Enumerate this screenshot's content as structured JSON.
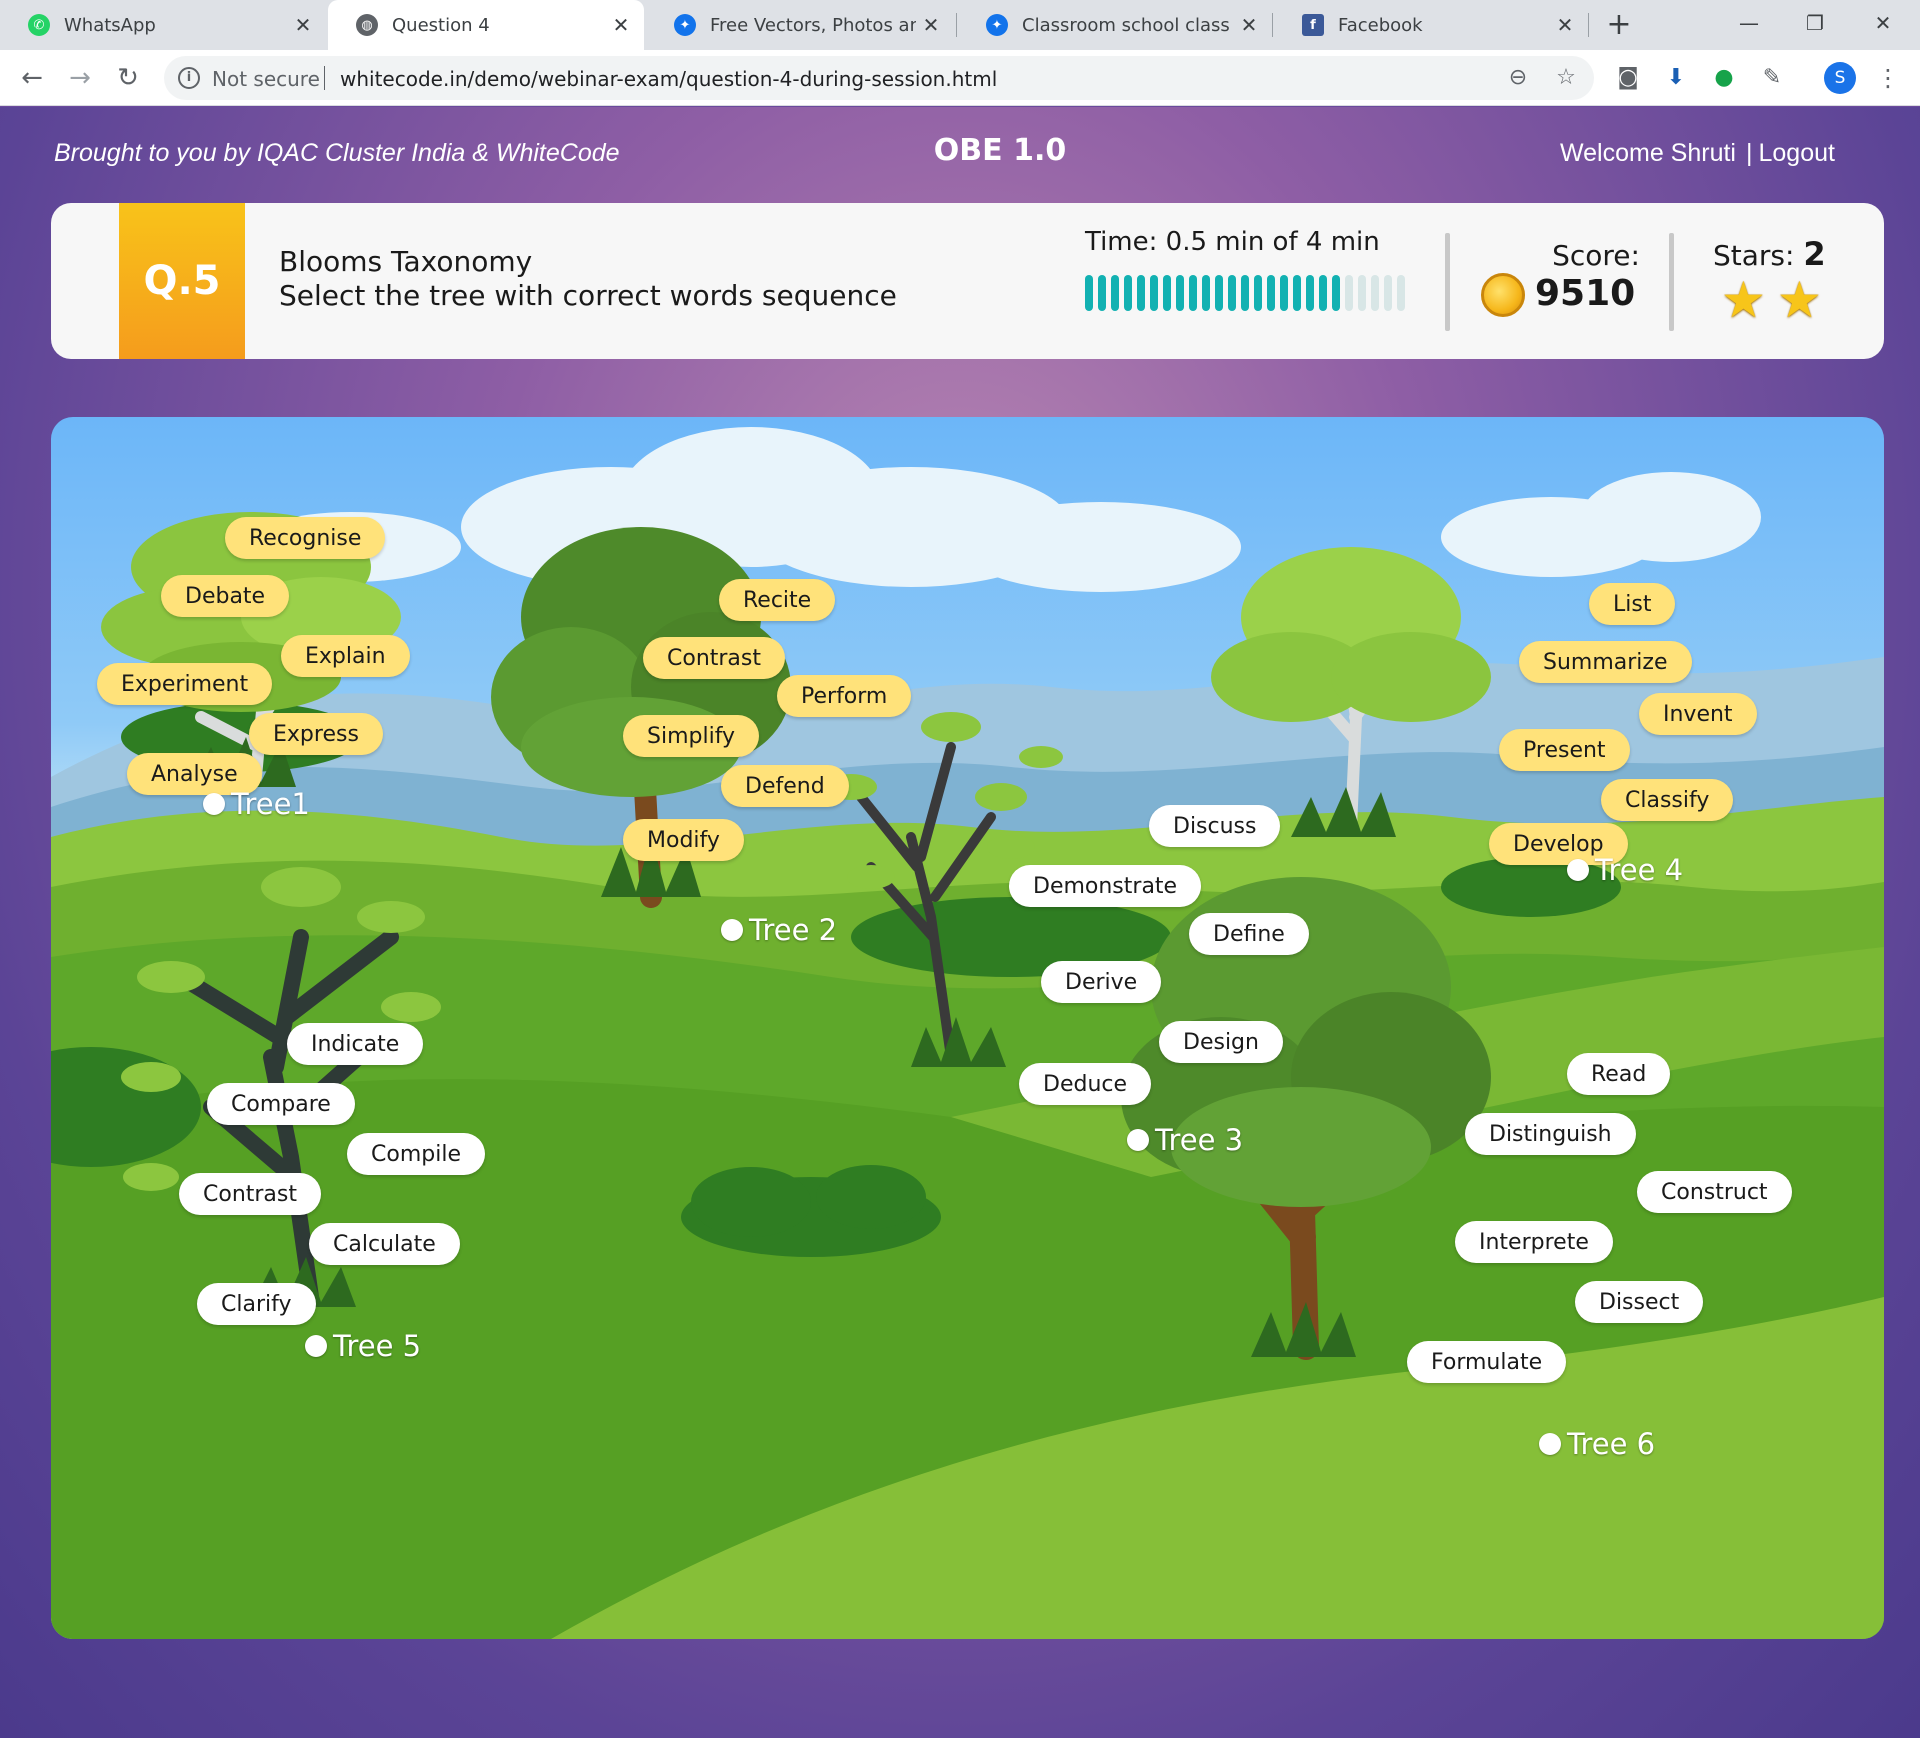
{
  "browser": {
    "tabs": [
      {
        "title": "WhatsApp",
        "icon": "whatsapp-icon",
        "active": false
      },
      {
        "title": "Question 4",
        "icon": "globe-icon",
        "active": true
      },
      {
        "title": "Free Vectors, Photos and PS",
        "icon": "freepik-icon",
        "active": false
      },
      {
        "title": "Classroom school class roo",
        "icon": "freepik-icon",
        "active": false
      },
      {
        "title": "Facebook",
        "icon": "facebook-icon",
        "active": false
      }
    ],
    "security": "Not secure",
    "url": "whitecode.in/demo/webinar-exam/question-4-during-session.html",
    "profile_initial": "S"
  },
  "header": {
    "brought_by": "Brought to you by IQAC Cluster India  & WhiteCode",
    "app_title": "OBE 1.0",
    "welcome": "Welcome Shruti",
    "logout": "Logout"
  },
  "question": {
    "number": "Q.5",
    "title": "Blooms Taxonomy",
    "text": "Select the tree with correct words sequence",
    "time_label": "Time:  0.5 min of 4 min",
    "time_used_min": 0.5,
    "time_total_min": 4,
    "time_bar_fill_fraction": 0.8,
    "score_label": "Score:",
    "score": "9510",
    "stars_label": "Stars:",
    "stars": "2",
    "stars_count": 2
  },
  "trees": [
    {
      "label": "Tree1",
      "color": "yellow",
      "words": [
        "Recognise",
        "Debate",
        "Explain",
        "Experiment",
        "Express",
        "Analyse"
      ]
    },
    {
      "label": "Tree 2",
      "color": "yellow",
      "words": [
        "Recite",
        "Contrast",
        "Perform",
        "Simplify",
        "Defend",
        "Modify"
      ]
    },
    {
      "label": "Tree 3",
      "color": "white",
      "words": [
        "Discuss",
        "Demonstrate",
        "Define",
        "Derive",
        "Design",
        "Deduce"
      ]
    },
    {
      "label": "Tree 4",
      "color": "yellow",
      "words": [
        "List",
        "Summarize",
        "Invent",
        "Present",
        "Classify",
        "Develop"
      ]
    },
    {
      "label": "Tree 5",
      "color": "white",
      "words": [
        "Indicate",
        "Compare",
        "Compile",
        "Contrast",
        "Calculate",
        "Clarify"
      ]
    },
    {
      "label": "Tree 6",
      "color": "white",
      "words": [
        "Read",
        "Distinguish",
        "Construct",
        "Interprete",
        "Dissect",
        "Formulate"
      ]
    }
  ],
  "colors": {
    "accent_teal": "#12b1b2",
    "badge_orange": "#f59c1c",
    "word_yellow": "#ffe27a",
    "word_white": "#ffffff"
  }
}
